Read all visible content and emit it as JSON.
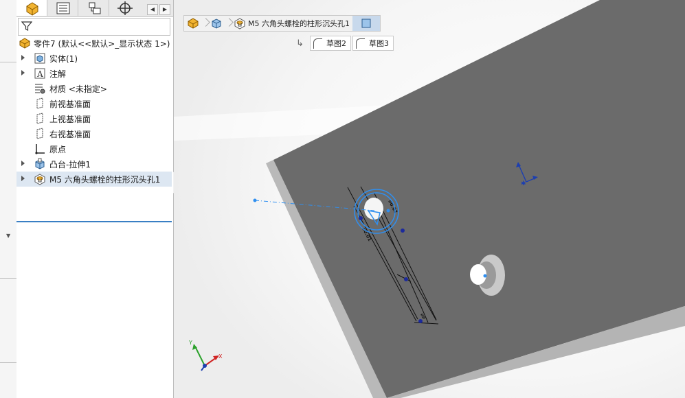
{
  "feature_tree": {
    "part_name": "零件7  (默认<<默认>_显示状态 1>)",
    "items": [
      {
        "label": "实体(1)",
        "icon": "solid-bodies-icon",
        "expandable": true
      },
      {
        "label": "注解",
        "icon": "annotations-icon",
        "expandable": true
      },
      {
        "label": "材质 <未指定>",
        "icon": "material-icon",
        "expandable": false
      },
      {
        "label": "前视基准面",
        "icon": "plane-icon",
        "expandable": false
      },
      {
        "label": "上视基准面",
        "icon": "plane-icon",
        "expandable": false
      },
      {
        "label": "右视基准面",
        "icon": "plane-icon",
        "expandable": false
      },
      {
        "label": "原点",
        "icon": "origin-icon",
        "expandable": false
      },
      {
        "label": "凸台-拉伸1",
        "icon": "boss-extrude-icon",
        "expandable": true
      },
      {
        "label": "M5 六角头螺栓的柱形沉头孔1",
        "icon": "hole-wizard-icon",
        "expandable": true,
        "selected": true
      }
    ]
  },
  "breadcrumb": {
    "feature_label": "M5 六角头螺栓的柱形沉头孔1"
  },
  "sketches": [
    {
      "label": "草图2"
    },
    {
      "label": "草图3"
    }
  ],
  "triad": {
    "x_label": "X",
    "y_label": "Y"
  },
  "colors": {
    "accent": "#3a7fc4",
    "part_face": "#6b6b6b",
    "part_edge": "#b4b4b4",
    "selection": "#2f8ff0",
    "sketch_point": "#1c2a9c"
  }
}
